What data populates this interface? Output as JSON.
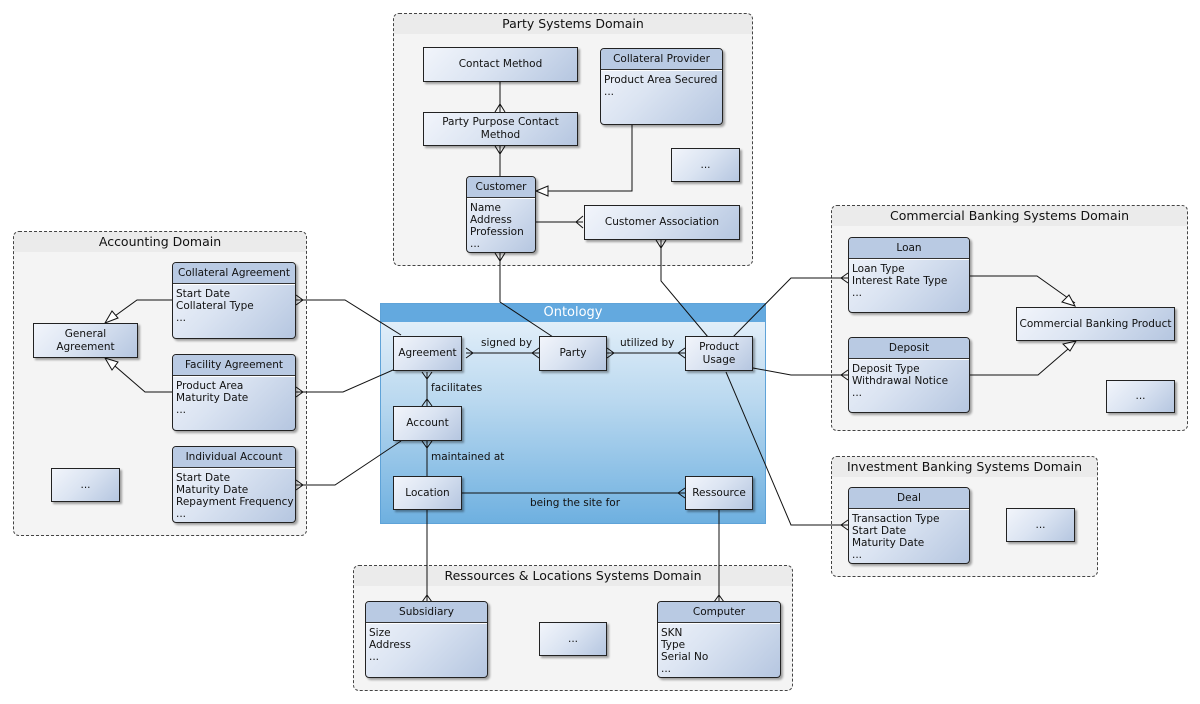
{
  "domains": {
    "party": "Party Systems Domain",
    "accounting": "Accounting Domain",
    "commercial": "Commercial Banking Systems Domain",
    "investment": "Investment Banking Systems Domain",
    "resources": "Ressources & Locations Systems Domain"
  },
  "ontology": {
    "title": "Ontology",
    "entities": {
      "agreement": "Agreement",
      "party": "Party",
      "product_usage": "Product Usage",
      "account": "Account",
      "location": "Location",
      "ressource": "Ressource"
    },
    "relations": {
      "signed_by": "signed by",
      "utilized_by": "utilized by",
      "facilitates": "facilitates",
      "maintained_at": "maintained at",
      "being_site_for": "being the site for"
    }
  },
  "party_domain": {
    "contact_method": "Contact Method",
    "party_purpose_contact_method": "Party Purpose Contact Method",
    "collateral_provider": {
      "title": "Collateral Provider",
      "attrs": [
        "Product Area Secured",
        "..."
      ]
    },
    "customer": {
      "title": "Customer",
      "attrs": [
        "Name",
        "Address",
        "Profession",
        "..."
      ]
    },
    "customer_association": "Customer Association",
    "more": "..."
  },
  "accounting_domain": {
    "general_agreement": "General Agreement",
    "collateral_agreement": {
      "title": "Collateral Agreement",
      "attrs": [
        "Start Date",
        "Collateral Type",
        "..."
      ]
    },
    "facility_agreement": {
      "title": "Facility Agreement",
      "attrs": [
        "Product Area",
        "Maturity Date",
        "..."
      ]
    },
    "individual_account": {
      "title": "Individual Account",
      "attrs": [
        "Start Date",
        "Maturity Date",
        "Repayment Frequency",
        "..."
      ]
    },
    "more": "..."
  },
  "commercial_domain": {
    "loan": {
      "title": "Loan",
      "attrs": [
        "Loan Type",
        "Interest Rate Type",
        "..."
      ]
    },
    "deposit": {
      "title": "Deposit",
      "attrs": [
        "Deposit Type",
        "Withdrawal Notice",
        "..."
      ]
    },
    "commercial_banking_product": "Commercial Banking Product",
    "more": "..."
  },
  "investment_domain": {
    "deal": {
      "title": "Deal",
      "attrs": [
        "Transaction Type",
        "Start Date",
        "Maturity Date",
        "..."
      ]
    },
    "more": "..."
  },
  "resources_domain": {
    "subsidiary": {
      "title": "Subsidiary",
      "attrs": [
        "Size",
        "Address",
        "..."
      ]
    },
    "computer": {
      "title": "Computer",
      "attrs": [
        "SKN",
        "Type",
        "Serial No",
        "..."
      ]
    },
    "more": "..."
  }
}
